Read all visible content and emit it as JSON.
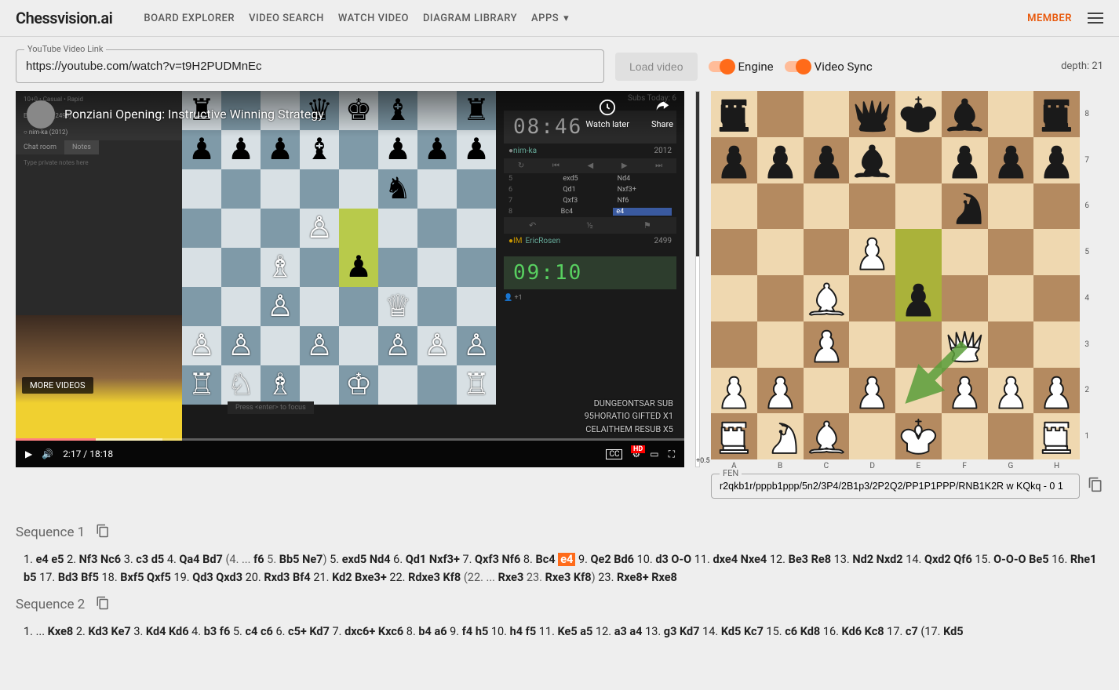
{
  "header": {
    "logo": "Chessvision.ai",
    "nav": [
      "BOARD EXPLORER",
      "VIDEO SEARCH",
      "WATCH VIDEO",
      "DIAGRAM LIBRARY",
      "APPS"
    ],
    "member": "MEMBER"
  },
  "controls": {
    "url_label": "YouTube Video Link",
    "url_value": "https://youtube.com/watch?v=t9H2PUDMnEc",
    "load_label": "Load video",
    "engine_label": "Engine",
    "sync_label": "Video Sync",
    "depth": "depth: 21"
  },
  "video": {
    "title": "Ponziani Opening: Instructive Winning Strategy",
    "watch_later": "Watch later",
    "share": "Share",
    "more_videos": "MORE VIDEOS",
    "time": "2:17 / 18:18",
    "cc": "CC",
    "subs_today": "Subs Today: 6",
    "top_player_name": "nim-ka",
    "top_player_rating": "2012",
    "top_clock": "08:46",
    "bot_player_name": "EricRosen",
    "bot_player_prefix": "IM",
    "bot_player_rating": "2499",
    "bot_clock": "09:10",
    "chat_header": "10+0 • Casual • Rapid",
    "chat_eric": "EricRosen (2499)",
    "chat_nim": "○ nim-ka (2012)",
    "tab_chat": "Chat room",
    "tab_notes": "Notes",
    "notes_placeholder": "Type private notes here",
    "focus_hint": "Press <enter> to focus",
    "bottom_lines": [
      "DUNGEONTSAR  SUB",
      "95HORATIO  GIFTED X1",
      "CELAITHEM  RESUB X5"
    ],
    "inner_moves": [
      {
        "n": "5",
        "w": "exd5",
        "b": "Nd4"
      },
      {
        "n": "6",
        "w": "Qd1",
        "b": "Nxf3+"
      },
      {
        "n": "7",
        "w": "Qxf3",
        "b": "Nf6"
      },
      {
        "n": "8",
        "w": "Bc4",
        "b": "e4"
      }
    ],
    "inner_board": {
      "light": "#d8e0e4",
      "dark": "#7f9aa8",
      "highlights": [
        "e5",
        "e4"
      ],
      "pieces": [
        {
          "sq": "a8",
          "t": "r",
          "c": "b"
        },
        {
          "sq": "d8",
          "t": "q",
          "c": "b"
        },
        {
          "sq": "e8",
          "t": "k",
          "c": "b"
        },
        {
          "sq": "f8",
          "t": "b",
          "c": "b"
        },
        {
          "sq": "h8",
          "t": "r",
          "c": "b"
        },
        {
          "sq": "a7",
          "t": "p",
          "c": "b"
        },
        {
          "sq": "b7",
          "t": "p",
          "c": "b"
        },
        {
          "sq": "c7",
          "t": "p",
          "c": "b"
        },
        {
          "sq": "d7",
          "t": "b",
          "c": "b"
        },
        {
          "sq": "f7",
          "t": "p",
          "c": "b"
        },
        {
          "sq": "g7",
          "t": "p",
          "c": "b"
        },
        {
          "sq": "h7",
          "t": "p",
          "c": "b"
        },
        {
          "sq": "f6",
          "t": "n",
          "c": "b"
        },
        {
          "sq": "d5",
          "t": "p",
          "c": "w"
        },
        {
          "sq": "c4",
          "t": "b",
          "c": "w"
        },
        {
          "sq": "e4",
          "t": "p",
          "c": "b"
        },
        {
          "sq": "c3",
          "t": "p",
          "c": "w"
        },
        {
          "sq": "f3",
          "t": "q",
          "c": "w"
        },
        {
          "sq": "a2",
          "t": "p",
          "c": "w"
        },
        {
          "sq": "b2",
          "t": "p",
          "c": "w"
        },
        {
          "sq": "d2",
          "t": "p",
          "c": "w"
        },
        {
          "sq": "f2",
          "t": "p",
          "c": "w"
        },
        {
          "sq": "g2",
          "t": "p",
          "c": "w"
        },
        {
          "sq": "h2",
          "t": "p",
          "c": "w"
        },
        {
          "sq": "a1",
          "t": "r",
          "c": "w"
        },
        {
          "sq": "b1",
          "t": "n",
          "c": "w"
        },
        {
          "sq": "c1",
          "t": "b",
          "c": "w"
        },
        {
          "sq": "e1",
          "t": "k",
          "c": "w"
        },
        {
          "sq": "h1",
          "t": "r",
          "c": "w"
        }
      ]
    }
  },
  "eval": {
    "value": "+0.5"
  },
  "analysis": {
    "fen_label": "FEN",
    "fen_value": "r2qkb1r/pppb1ppp/5n2/3P4/2B1p3/2P2Q2/PP1P1PPP/RNB1K2R w KQkq - 0 1",
    "highlights": [
      "e5",
      "e4"
    ],
    "arrow": {
      "from": "f3",
      "to": "e2"
    },
    "pieces": [
      {
        "sq": "a8",
        "t": "r",
        "c": "b"
      },
      {
        "sq": "d8",
        "t": "q",
        "c": "b"
      },
      {
        "sq": "e8",
        "t": "k",
        "c": "b"
      },
      {
        "sq": "f8",
        "t": "b",
        "c": "b"
      },
      {
        "sq": "h8",
        "t": "r",
        "c": "b"
      },
      {
        "sq": "a7",
        "t": "p",
        "c": "b"
      },
      {
        "sq": "b7",
        "t": "p",
        "c": "b"
      },
      {
        "sq": "c7",
        "t": "p",
        "c": "b"
      },
      {
        "sq": "d7",
        "t": "b",
        "c": "b"
      },
      {
        "sq": "f7",
        "t": "p",
        "c": "b"
      },
      {
        "sq": "g7",
        "t": "p",
        "c": "b"
      },
      {
        "sq": "h7",
        "t": "p",
        "c": "b"
      },
      {
        "sq": "f6",
        "t": "n",
        "c": "b"
      },
      {
        "sq": "d5",
        "t": "p",
        "c": "w"
      },
      {
        "sq": "c4",
        "t": "b",
        "c": "w"
      },
      {
        "sq": "e4",
        "t": "p",
        "c": "b"
      },
      {
        "sq": "c3",
        "t": "p",
        "c": "w"
      },
      {
        "sq": "f3",
        "t": "q",
        "c": "w"
      },
      {
        "sq": "a2",
        "t": "p",
        "c": "w"
      },
      {
        "sq": "b2",
        "t": "p",
        "c": "w"
      },
      {
        "sq": "d2",
        "t": "p",
        "c": "w"
      },
      {
        "sq": "f2",
        "t": "p",
        "c": "w"
      },
      {
        "sq": "g2",
        "t": "p",
        "c": "w"
      },
      {
        "sq": "h2",
        "t": "p",
        "c": "w"
      },
      {
        "sq": "a1",
        "t": "r",
        "c": "w"
      },
      {
        "sq": "b1",
        "t": "n",
        "c": "w"
      },
      {
        "sq": "c1",
        "t": "b",
        "c": "w"
      },
      {
        "sq": "e1",
        "t": "k",
        "c": "w"
      },
      {
        "sq": "h1",
        "t": "r",
        "c": "w"
      }
    ]
  },
  "sequences": [
    {
      "title": "Sequence 1",
      "moves": "1. |e4 e5| 2. |Nf3 Nc6| 3. |c3 d5| 4. |Qa4 Bd7| (4. ... |f6| 5. |Bb5 Ne7|) 5. |exd5 Nd4| 6. |Qd1 Nxf3+| 7. |Qxf3 Nf6| 8. |Bc4| *e4* 9. |Qe2 Bd6| 10. |d3 O-O| 11. |dxe4 Nxe4| 12. |Be3 Re8| 13. |Nd2 Nxd2| 14. |Qxd2 Qf6| 15. |O-O-O Be5| 16. |Rhe1 b5| 17. |Bd3 Bf5| 18. |Bxf5 Qxf5| 19. |Qd3 Qxd3| 20. |Rxd3 Bf4| 21. |Kd2 Bxe3+| 22. |Rdxe3 Kf8| (22. ... |Rxe3| 23. |Rxe3 Kf8|) 23. |Rxe8+ Rxe8|"
    },
    {
      "title": "Sequence 2",
      "moves": "1. ... |Kxe8| 2. |Kd3 Ke7| 3. |Kd4 Kd6| 4. |b3 f6| 5. |c4 c6| 6. |c5+ Kd7| 7. |dxc6+ Kxc6| 8. |b4 a6| 9. |f4 h5| 10. |h4 f5| 11. |Ke5 a5| 12. |a3 a4| 13. |g3 Kd7| 14. |Kd5 Kc7| 15. |c6 Kd8| 16. |Kd6 Kc8| 17. |c7| (17. |Kd5|"
    }
  ]
}
